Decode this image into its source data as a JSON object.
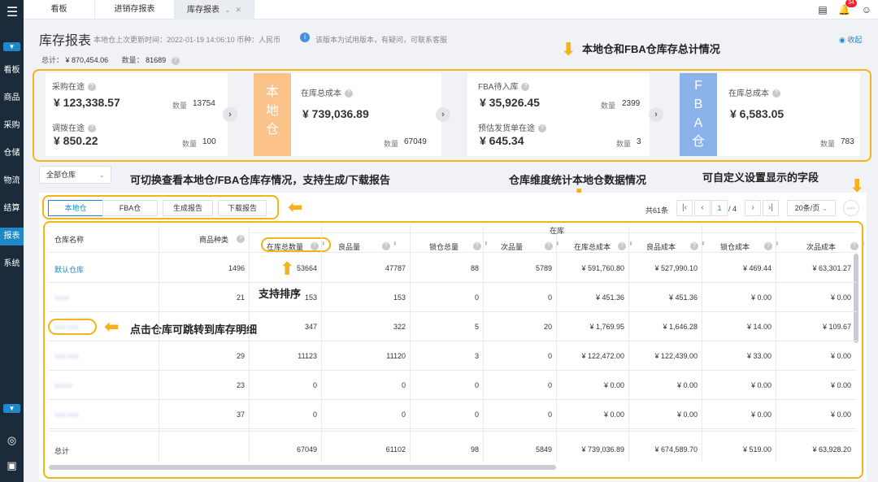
{
  "tabs": [
    {
      "label": "看板"
    },
    {
      "label": "进销存报表"
    },
    {
      "label": "库存报表"
    }
  ],
  "tab_close": "✕",
  "notification_count": "34",
  "sidebar": {
    "items": [
      {
        "label": "看板"
      },
      {
        "label": "商品"
      },
      {
        "label": "采购"
      },
      {
        "label": "仓储"
      },
      {
        "label": "物流"
      },
      {
        "label": "结算"
      },
      {
        "label": "报表"
      },
      {
        "label": "系统"
      }
    ]
  },
  "header": {
    "title": "库存报表",
    "update_prefix": "本地仓上次更新时间：",
    "update_time": "2022-01-19 14:06:10",
    "currency_label": "币种：",
    "currency": "人民币",
    "notice": "该版本为试用版本，有疑问，可联系客服",
    "collapse": "收起",
    "total_label": "总计：",
    "total_value": "¥ 870,454.06",
    "count_label": "数量：",
    "count_value": "81689"
  },
  "cards": {
    "purchase_in_transit": {
      "label": "采购在途",
      "value": "¥ 123,338.57",
      "qty_label": "数量",
      "qty": "13754"
    },
    "transfer_in_transit": {
      "label": "调拨在途",
      "value": "¥ 850.22",
      "qty_label": "数量",
      "qty": "100"
    },
    "local_block": "本地仓",
    "local_total_cost": {
      "label": "在库总成本",
      "value": "¥ 739,036.89",
      "qty_label": "数量",
      "qty": "67049"
    },
    "fba_pending": {
      "label": "FBA待入库",
      "value": "¥ 35,926.45",
      "qty_label": "数量",
      "qty": "2399"
    },
    "estimated_shipment": {
      "label": "预估发货单在途",
      "value": "¥ 645.34",
      "qty_label": "数量",
      "qty": "3"
    },
    "fba_block": "FBA仓",
    "fba_total_cost": {
      "label": "在库总成本",
      "value": "¥ 6,583.05",
      "qty_label": "数量",
      "qty": "783"
    }
  },
  "annotations": {
    "summary": "本地仓和FBA仓库存总计情况",
    "switch": "可切换查看本地仓/FBA仓库存情况，支持生成/下载报告",
    "dimension": "仓库维度统计本地仓数据情况",
    "customize": "可自定义设置显示的字段",
    "sort": "支持排序",
    "jump": "点击仓库可跳转到库存明细"
  },
  "filter": {
    "warehouse_select": "全部仓库"
  },
  "toolbar": {
    "local": "本地仓",
    "fba": "FBA仓",
    "generate": "生成报告",
    "download": "下载报告"
  },
  "pager": {
    "total": "共61条",
    "current": "1",
    "pages": "/ 4",
    "page_size": "20条/页"
  },
  "table": {
    "group_header": "在库",
    "columns": [
      "仓库名称",
      "商品种类",
      "在库总数量",
      "良品量",
      "锁仓总量",
      "次品量",
      "在库总成本",
      "良品成本",
      "锁仓成本",
      "次品成本"
    ],
    "rows": [
      [
        "默认仓库",
        "1496",
        "53664",
        "47787",
        "88",
        "5789",
        "¥ 591,760.80",
        "¥ 527,990.10",
        "¥ 469.44",
        "¥ 63,301.27"
      ],
      [
        "xxxx",
        "21",
        "153",
        "153",
        "0",
        "0",
        "¥ 451.36",
        "¥ 451.36",
        "¥ 0.00",
        "¥ 0.00"
      ],
      [
        "xxx-xxx",
        "",
        "347",
        "322",
        "5",
        "20",
        "¥ 1,769.95",
        "¥ 1,646.28",
        "¥ 14.00",
        "¥ 109.67"
      ],
      [
        "xxx-xxx",
        "29",
        "11123",
        "11120",
        "3",
        "0",
        "¥ 122,472.00",
        "¥ 122,439.00",
        "¥ 33.00",
        "¥ 0.00"
      ],
      [
        "xxxxx",
        "23",
        "0",
        "0",
        "0",
        "0",
        "¥ 0.00",
        "¥ 0.00",
        "¥ 0.00",
        "¥ 0.00"
      ],
      [
        "xxx-xxx",
        "37",
        "0",
        "0",
        "0",
        "0",
        "¥ 0.00",
        "¥ 0.00",
        "¥ 0.00",
        "¥ 0.00"
      ]
    ],
    "total_row": [
      "总计",
      "",
      "67049",
      "61102",
      "98",
      "5849",
      "¥ 739,036.89",
      "¥ 674,589.70",
      "¥ 519.00",
      "¥ 63,928.20"
    ]
  },
  "colors": {
    "accent": "#1e88c8",
    "highlight": "#f5b317",
    "local_block": "#fbc289",
    "fba_block": "#8ab3ea",
    "sidebar": "#1c2b3a"
  }
}
